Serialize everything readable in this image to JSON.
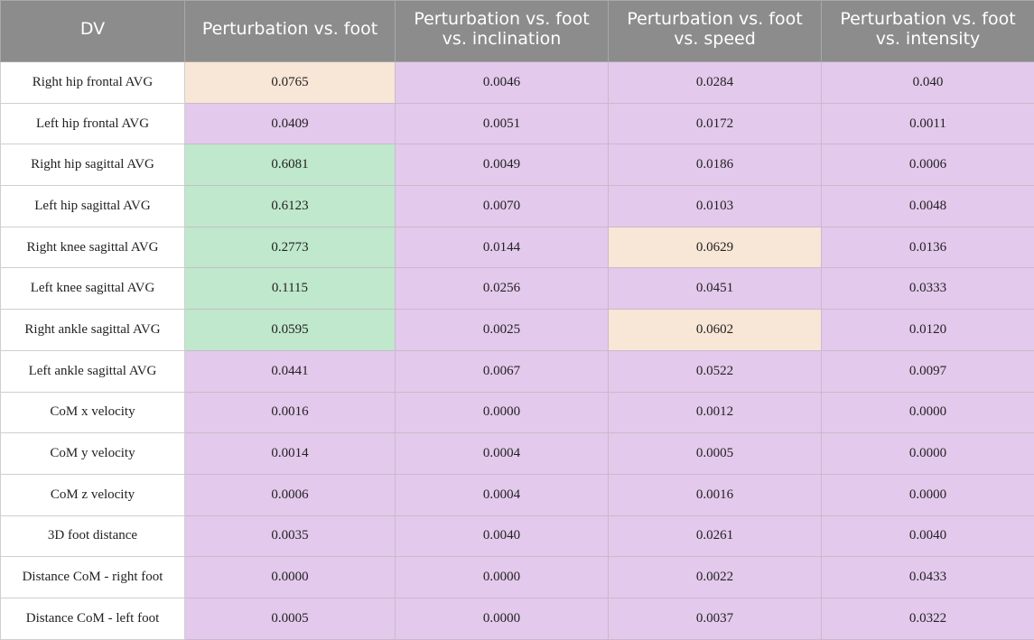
{
  "colors": {
    "header": "#8c8c8c",
    "purple": "#e3c9ec",
    "green": "#bfe8cc",
    "peach": "#f8e6d6"
  },
  "header": [
    "DV",
    "Perturbation vs. foot",
    "Perturbation vs. foot vs. inclination",
    "Perturbation vs. foot vs. speed",
    "Perturbation vs. foot vs. intensity"
  ],
  "rows": [
    {
      "dv": "Right hip frontal AVG",
      "values": [
        "0.0765",
        "0.0046",
        "0.0284",
        "0.040"
      ],
      "colors": [
        "peach",
        "purple",
        "purple",
        "purple"
      ]
    },
    {
      "dv": "Left hip frontal AVG",
      "values": [
        "0.0409",
        "0.0051",
        "0.0172",
        "0.0011"
      ],
      "colors": [
        "purple",
        "purple",
        "purple",
        "purple"
      ]
    },
    {
      "dv": "Right hip sagittal AVG",
      "values": [
        "0.6081",
        "0.0049",
        "0.0186",
        "0.0006"
      ],
      "colors": [
        "green",
        "purple",
        "purple",
        "purple"
      ]
    },
    {
      "dv": "Left hip sagittal AVG",
      "values": [
        "0.6123",
        "0.0070",
        "0.0103",
        "0.0048"
      ],
      "colors": [
        "green",
        "purple",
        "purple",
        "purple"
      ]
    },
    {
      "dv": "Right knee sagittal AVG",
      "values": [
        "0.2773",
        "0.0144",
        "0.0629",
        "0.0136"
      ],
      "colors": [
        "green",
        "purple",
        "peach",
        "purple"
      ]
    },
    {
      "dv": "Left knee sagittal AVG",
      "values": [
        "0.1115",
        "0.0256",
        "0.0451",
        "0.0333"
      ],
      "colors": [
        "green",
        "purple",
        "purple",
        "purple"
      ]
    },
    {
      "dv": "Right ankle sagittal AVG",
      "values": [
        "0.0595",
        "0.0025",
        "0.0602",
        "0.0120"
      ],
      "colors": [
        "green",
        "purple",
        "peach",
        "purple"
      ]
    },
    {
      "dv": "Left ankle sagittal AVG",
      "values": [
        "0.0441",
        "0.0067",
        "0.0522",
        "0.0097"
      ],
      "colors": [
        "purple",
        "purple",
        "purple",
        "purple"
      ]
    },
    {
      "dv": "CoM x velocity",
      "values": [
        "0.0016",
        "0.0000",
        "0.0012",
        "0.0000"
      ],
      "colors": [
        "purple",
        "purple",
        "purple",
        "purple"
      ]
    },
    {
      "dv": "CoM y velocity",
      "values": [
        "0.0014",
        "0.0004",
        "0.0005",
        "0.0000"
      ],
      "colors": [
        "purple",
        "purple",
        "purple",
        "purple"
      ]
    },
    {
      "dv": "CoM z velocity",
      "values": [
        "0.0006",
        "0.0004",
        "0.0016",
        "0.0000"
      ],
      "colors": [
        "purple",
        "purple",
        "purple",
        "purple"
      ]
    },
    {
      "dv": "3D foot distance",
      "values": [
        "0.0035",
        "0.0040",
        "0.0261",
        "0.0040"
      ],
      "colors": [
        "purple",
        "purple",
        "purple",
        "purple"
      ]
    },
    {
      "dv": "Distance CoM - right foot",
      "values": [
        "0.0000",
        "0.0000",
        "0.0022",
        "0.0433"
      ],
      "colors": [
        "purple",
        "purple",
        "purple",
        "purple"
      ]
    },
    {
      "dv": "Distance CoM - left foot",
      "values": [
        "0.0005",
        "0.0000",
        "0.0037",
        "0.0322"
      ],
      "colors": [
        "purple",
        "purple",
        "purple",
        "purple"
      ]
    }
  ]
}
